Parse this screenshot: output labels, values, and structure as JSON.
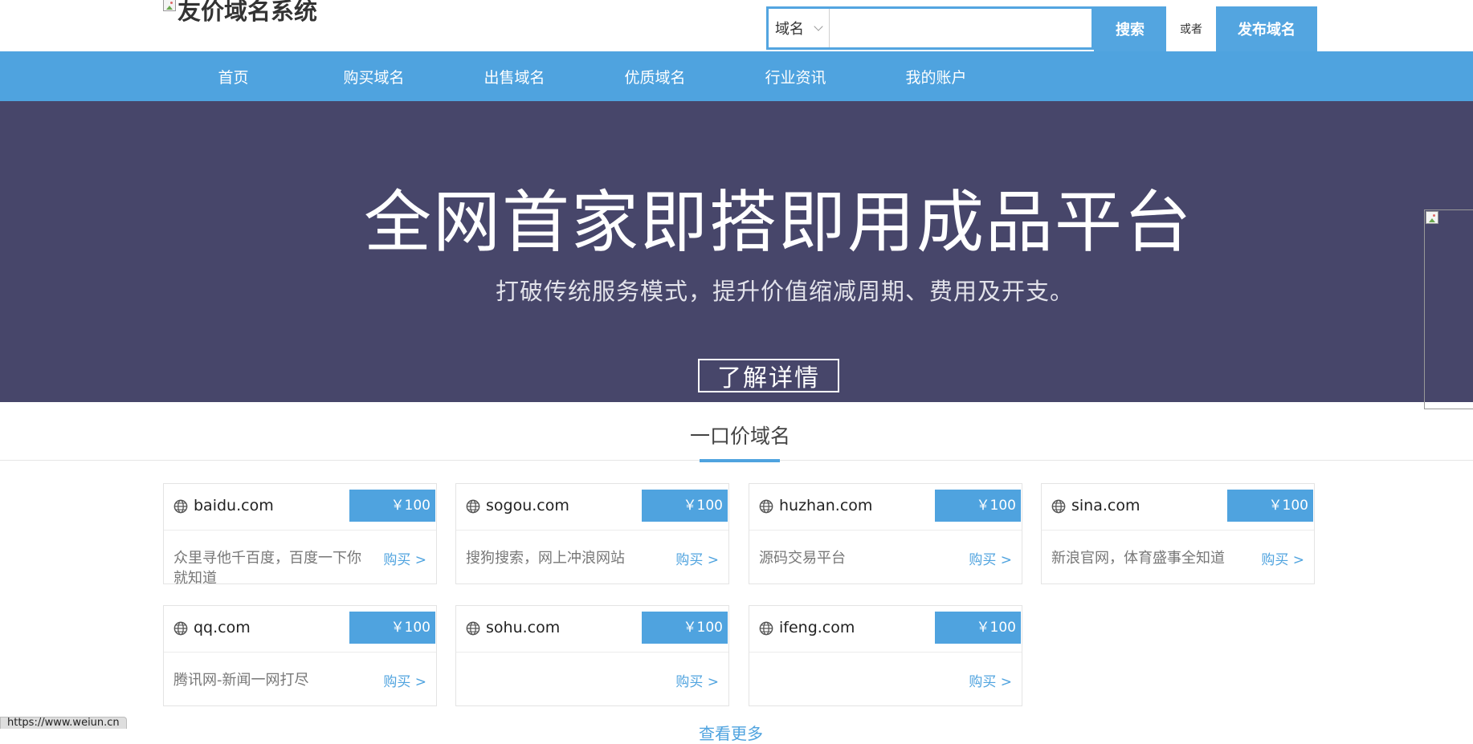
{
  "header": {
    "logo_text": "友价域名系统",
    "search_type": "域名",
    "search_placeholder": "",
    "search_button": "搜索",
    "or_label": "或者",
    "publish_button": "发布域名"
  },
  "nav": {
    "items": [
      "首页",
      "购买域名",
      "出售域名",
      "优质域名",
      "行业资讯",
      "我的账户"
    ]
  },
  "banner": {
    "title": "全网首家即搭即用成品平台",
    "subtitle": "打破传统服务模式，提升价值缩减周期、费用及开支。",
    "button": "了解详情"
  },
  "section": {
    "title": "一口价域名",
    "more_link": "查看更多",
    "buy_label": "购买 >",
    "domains": [
      {
        "domain": "baidu.com",
        "price": "￥100",
        "desc": "众里寻他千百度，百度一下你就知道"
      },
      {
        "domain": "sogou.com",
        "price": "￥100",
        "desc": "搜狗搜索，网上冲浪网站"
      },
      {
        "domain": "huzhan.com",
        "price": "￥100",
        "desc": "源码交易平台"
      },
      {
        "domain": "sina.com",
        "price": "￥100",
        "desc": "新浪官网，体育盛事全知道"
      },
      {
        "domain": "qq.com",
        "price": "￥100",
        "desc": "腾讯网-新闻一网打尽"
      },
      {
        "domain": "sohu.com",
        "price": "￥100",
        "desc": ""
      },
      {
        "domain": "ifeng.com",
        "price": "￥100",
        "desc": ""
      }
    ]
  },
  "status_bar": {
    "url": "https://www.weiun.cn"
  },
  "colors": {
    "accent": "#4fa3df",
    "banner_bg": "#47466a"
  }
}
